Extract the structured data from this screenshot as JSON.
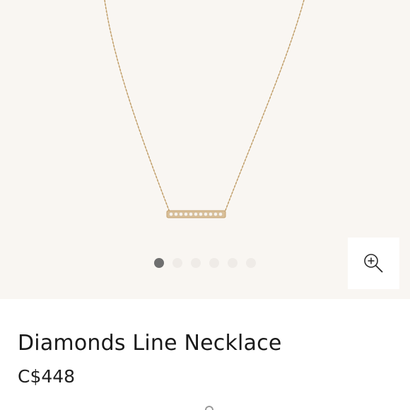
{
  "gallery": {
    "image_alt": "Diamonds Line Necklace",
    "slide_count": 6,
    "active_slide": 1,
    "zoom_icon": "zoom-in-icon",
    "colors": {
      "background": "#f9f6f2",
      "chain": "#c9a874",
      "bar_gold": "#d2b48c",
      "diamond": "#f4efe9",
      "dot_active": "#6f6f6f",
      "dot_inactive": "#efebe7"
    }
  },
  "product": {
    "title": "Diamonds Line Necklace",
    "price": "C$448"
  }
}
